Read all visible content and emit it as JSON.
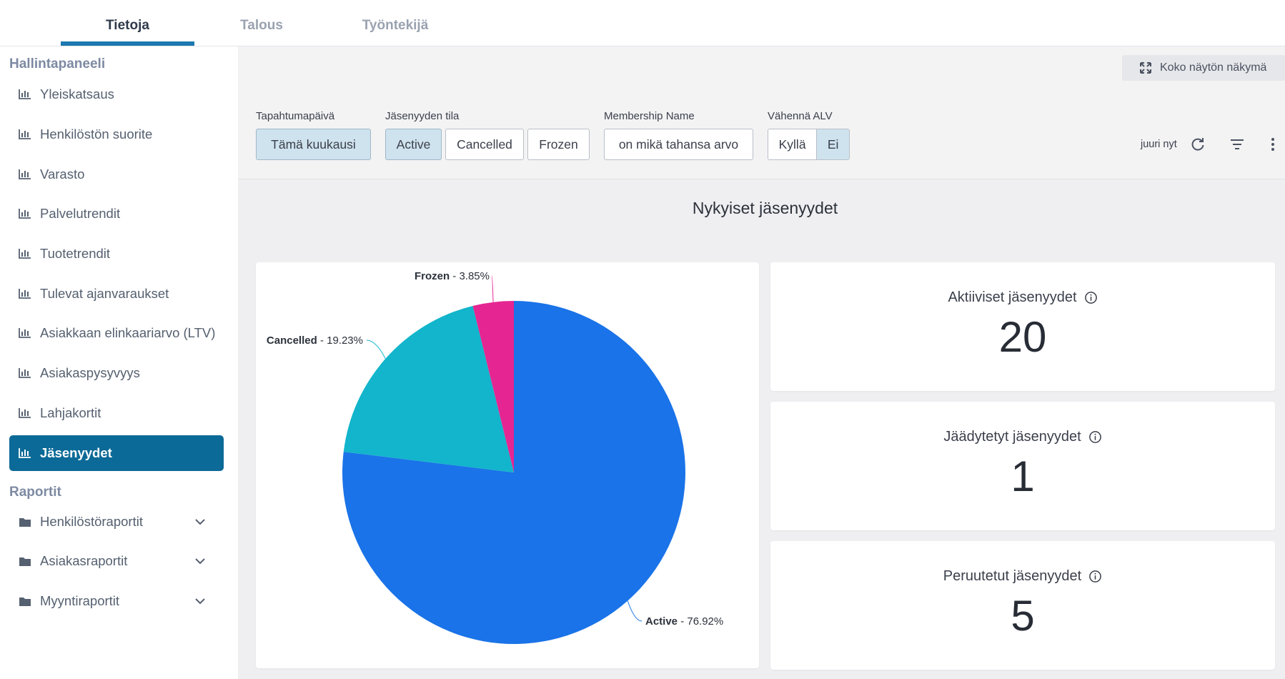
{
  "tabs": [
    "Tietoja",
    "Talous",
    "Työntekijä"
  ],
  "sidebar": {
    "dashboard_title": "Hallintapaneeli",
    "items": [
      {
        "label": "Yleiskatsaus"
      },
      {
        "label": "Henkilöstön suorite"
      },
      {
        "label": "Varasto"
      },
      {
        "label": "Palvelutrendit"
      },
      {
        "label": "Tuotetrendit"
      },
      {
        "label": "Tulevat ajanvaraukset"
      },
      {
        "label": "Asiakkaan elinkaariarvo (LTV)"
      },
      {
        "label": "Asiakaspysyvyys"
      },
      {
        "label": "Lahjakortit"
      },
      {
        "label": "Jäsenyydet"
      }
    ],
    "reports_title": "Raportit",
    "reports": [
      {
        "label": "Henkilöstöraportit"
      },
      {
        "label": "Asiakasraportit"
      },
      {
        "label": "Myyntiraportit"
      }
    ]
  },
  "toolbar": {
    "fullscreen_label": "Koko näytön näkymä",
    "updated": "juuri nyt"
  },
  "filters": {
    "event_date": {
      "label": "Tapahtumapäivä",
      "value": "Tämä kuukausi"
    },
    "membership_status": {
      "label": "Jäsenyyden tila",
      "options": [
        "Active",
        "Cancelled",
        "Frozen"
      ]
    },
    "membership_name": {
      "label": "Membership Name",
      "value": "on mikä tahansa arvo"
    },
    "vat": {
      "label": "Vähennä ALV",
      "options": [
        "Kyllä",
        "Ei"
      ]
    }
  },
  "dashboard_title": "Nykyiset jäsenyydet",
  "chart_data": {
    "type": "pie",
    "slices": [
      {
        "name": "Active",
        "value": 76.92,
        "label": " - 76.92%",
        "color": "#1a73e8"
      },
      {
        "name": "Cancelled",
        "value": 19.23,
        "label": " - 19.23%",
        "color": "#12b5cb"
      },
      {
        "name": "Frozen",
        "value": 3.85,
        "label": " - 3.85%",
        "color": "#e52592"
      }
    ]
  },
  "kpis": [
    {
      "title": "Aktiiviset jäsenyydet",
      "value": "20"
    },
    {
      "title": "Jäädytetyt jäsenyydet",
      "value": "1"
    },
    {
      "title": "Peruutetut jäsenyydet",
      "value": "5"
    }
  ],
  "colors": {
    "accent": "#0b6a97",
    "tab_underline": "#1c78b0",
    "selected_filter": "#cfe3ee"
  }
}
